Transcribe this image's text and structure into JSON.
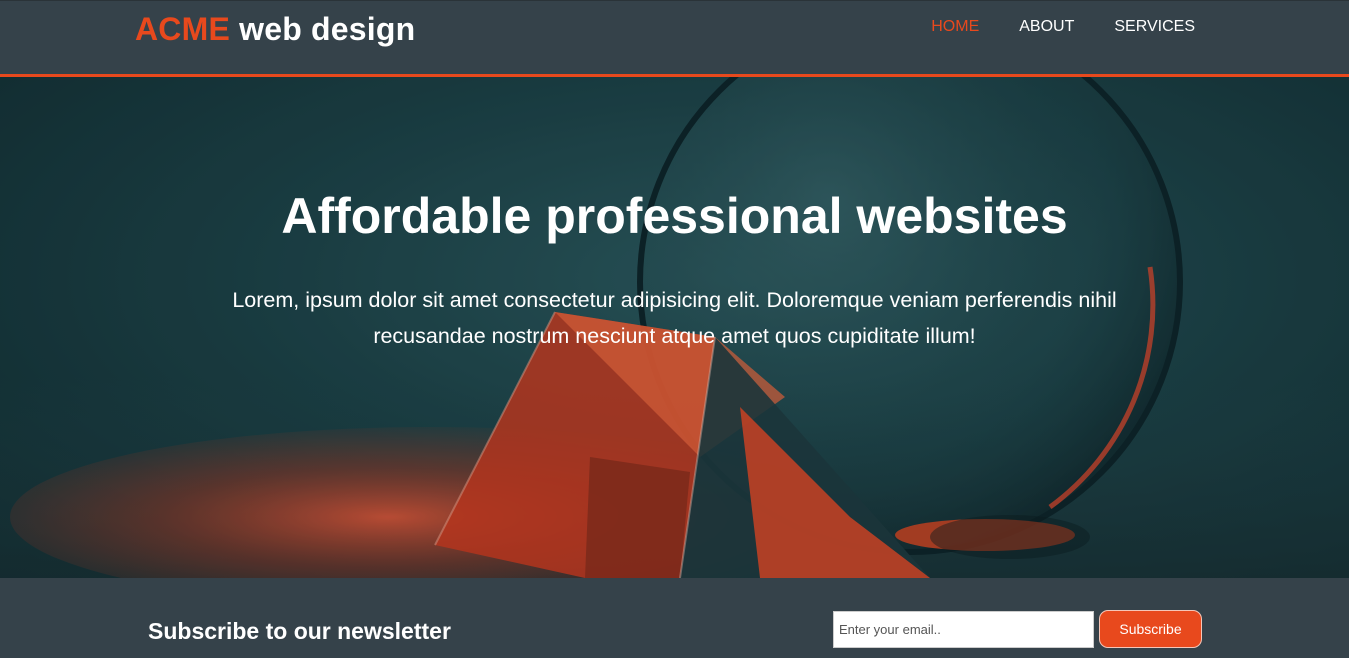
{
  "colors": {
    "accent": "#e8491d",
    "header_bg": "#35424a",
    "text_light": "#ffffff"
  },
  "header": {
    "logo_brand": "ACME",
    "logo_rest": "web design",
    "nav": [
      {
        "label": "HOME",
        "active": true
      },
      {
        "label": "ABOUT",
        "active": false
      },
      {
        "label": "SERVICES",
        "active": false
      }
    ]
  },
  "hero": {
    "title": "Affordable professional websites",
    "text": "Lorem, ipsum dolor sit amet consectetur adipisicing elit. Doloremque veniam perferendis nihil recusandae nostrum nesciunt atque amet quos cupiditate illum!"
  },
  "newsletter": {
    "title": "Subscribe to our newsletter",
    "email_placeholder": "Enter your email..",
    "email_value": "",
    "button_label": "Subscribe"
  }
}
